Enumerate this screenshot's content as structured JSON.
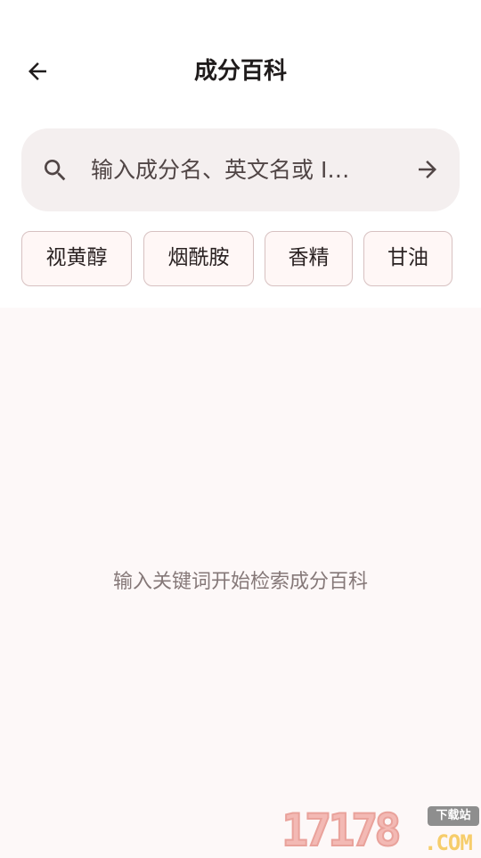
{
  "header": {
    "title": "成分百科",
    "back_icon": "arrow-left-icon"
  },
  "search": {
    "placeholder": "输入成分名、英文名或 I…",
    "value": "",
    "search_icon": "search-icon",
    "submit_icon": "arrow-right-icon"
  },
  "chips": [
    {
      "label": "视黄醇"
    },
    {
      "label": "烟酰胺"
    },
    {
      "label": "香精"
    },
    {
      "label": "甘油"
    }
  ],
  "empty_state": {
    "message": "输入关键词开始检索成分百科"
  },
  "watermark": {
    "digits": "17178",
    "domain": ".COM",
    "badge": "下载站"
  },
  "colors": {
    "background": "#fdf8f8",
    "search_bg": "#f4efef",
    "chip_border": "#d7c1c1",
    "chip_bg": "#fff7f6",
    "muted_text": "#857878"
  }
}
